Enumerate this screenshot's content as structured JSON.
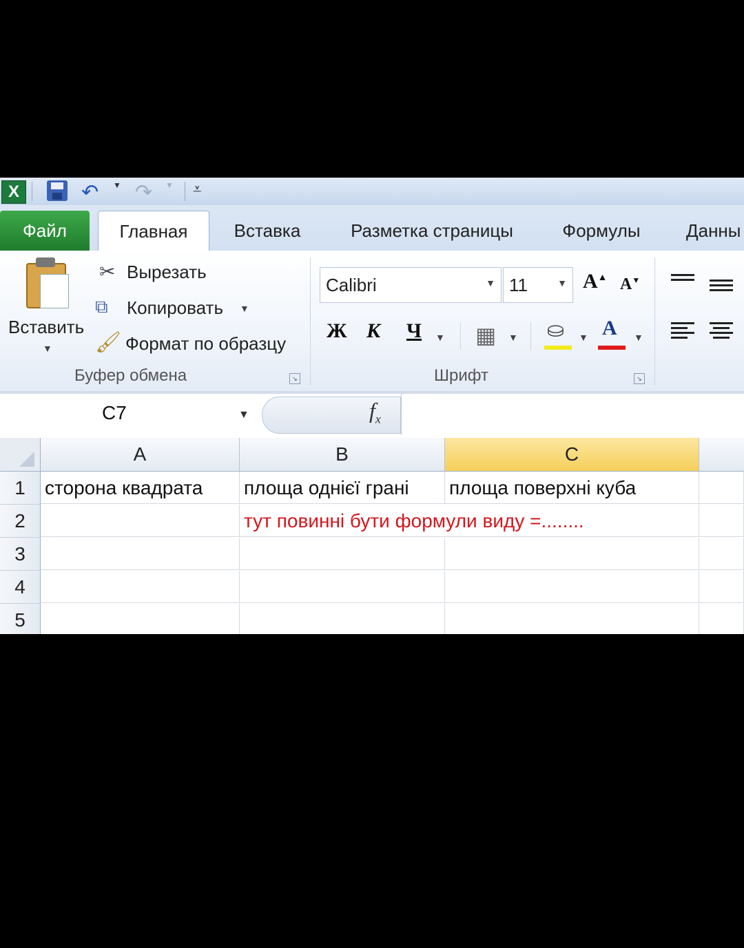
{
  "quick_access": {
    "app_icon": "X"
  },
  "tabs": [
    "Файл",
    "Главная",
    "Вставка",
    "Разметка страницы",
    "Формулы",
    "Данны"
  ],
  "clipboard": {
    "paste_label": "Вставить",
    "cut_label": "Вырезать",
    "copy_label": "Копировать",
    "format_painter_label": "Формат по образцу",
    "group_label": "Буфер обмена"
  },
  "font": {
    "font_name": "Calibri",
    "font_size": "11",
    "bold": "Ж",
    "italic": "К",
    "underline": "Ч",
    "grow": "A",
    "shrink": "A",
    "font_color_letter": "A",
    "group_label": "Шрифт"
  },
  "colors": {
    "fill_color": "#f3ea1a",
    "font_color": "#e01b1b",
    "file_tab": "#2e9640"
  },
  "formula_bar": {
    "name_box": "C7",
    "fx": "fx",
    "formula": ""
  },
  "sheet": {
    "columns": [
      "A",
      "B",
      "C"
    ],
    "selected_column": "C",
    "rows": [
      "1",
      "2",
      "3",
      "4",
      "5"
    ],
    "cells": {
      "A1": "сторона квадрата",
      "B1": "площа однієї грані",
      "C1": "площа поверхні куба",
      "B2": "тут повинні бути формули виду =........"
    }
  }
}
